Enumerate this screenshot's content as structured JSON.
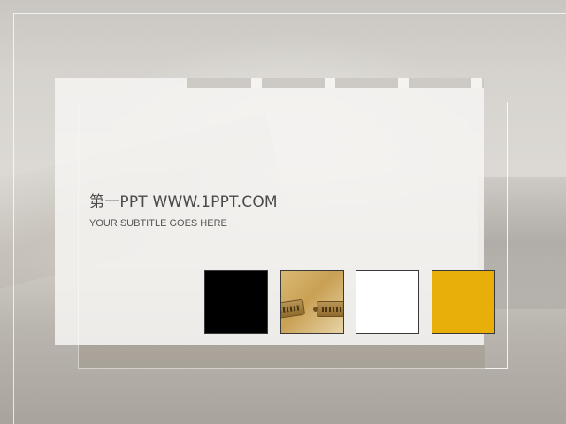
{
  "slide": {
    "title": "第一PPT WWW.1PPT.COM",
    "subtitle": "YOUR SUBTITLE  GOES HERE"
  },
  "swatches": [
    {
      "name": "black",
      "color": "#000000"
    },
    {
      "name": "photo",
      "color": "#c9a054"
    },
    {
      "name": "white",
      "color": "#ffffff"
    },
    {
      "name": "gold",
      "color": "#e8ae09"
    }
  ],
  "colors": {
    "background": "#d6d3ce",
    "card": "#f6f5f2",
    "title_text": "#4a4a4a",
    "subtitle_text": "#555555"
  }
}
